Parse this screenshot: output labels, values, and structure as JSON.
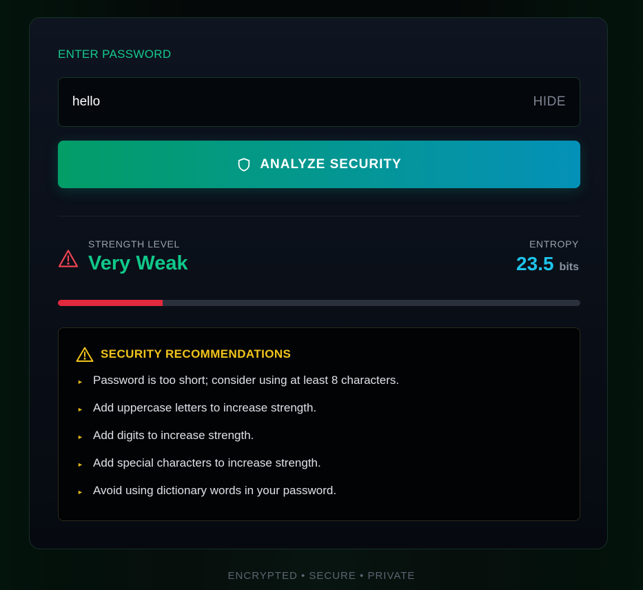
{
  "form": {
    "label": "ENTER PASSWORD",
    "password_value": "hello",
    "hide_label": "HIDE",
    "analyze_label": "ANALYZE SECURITY"
  },
  "result": {
    "strength_label": "STRENGTH LEVEL",
    "strength_value": "Very Weak",
    "entropy_label": "ENTROPY",
    "entropy_value": "23.5",
    "entropy_unit": "bits",
    "strength_fraction": 0.2
  },
  "recommendations": {
    "title": "SECURITY RECOMMENDATIONS",
    "items": [
      "Password is too short; consider using at least 8 characters.",
      "Add uppercase letters to increase strength.",
      "Add digits to increase strength.",
      "Add special characters to increase strength.",
      "Avoid using dictionary words in your password."
    ]
  },
  "footer": "ENCRYPTED • SECURE • PRIVATE",
  "colors": {
    "accent_green": "#10c98a",
    "accent_cyan": "#1ec3ea",
    "danger_red": "#e2293d",
    "warning_yellow": "#f2c41b"
  },
  "icons": {
    "analyze": "shield-icon",
    "strength": "warning-triangle-icon",
    "recommendations": "warning-triangle-icon",
    "list_bullet": "arrow-right-icon"
  }
}
